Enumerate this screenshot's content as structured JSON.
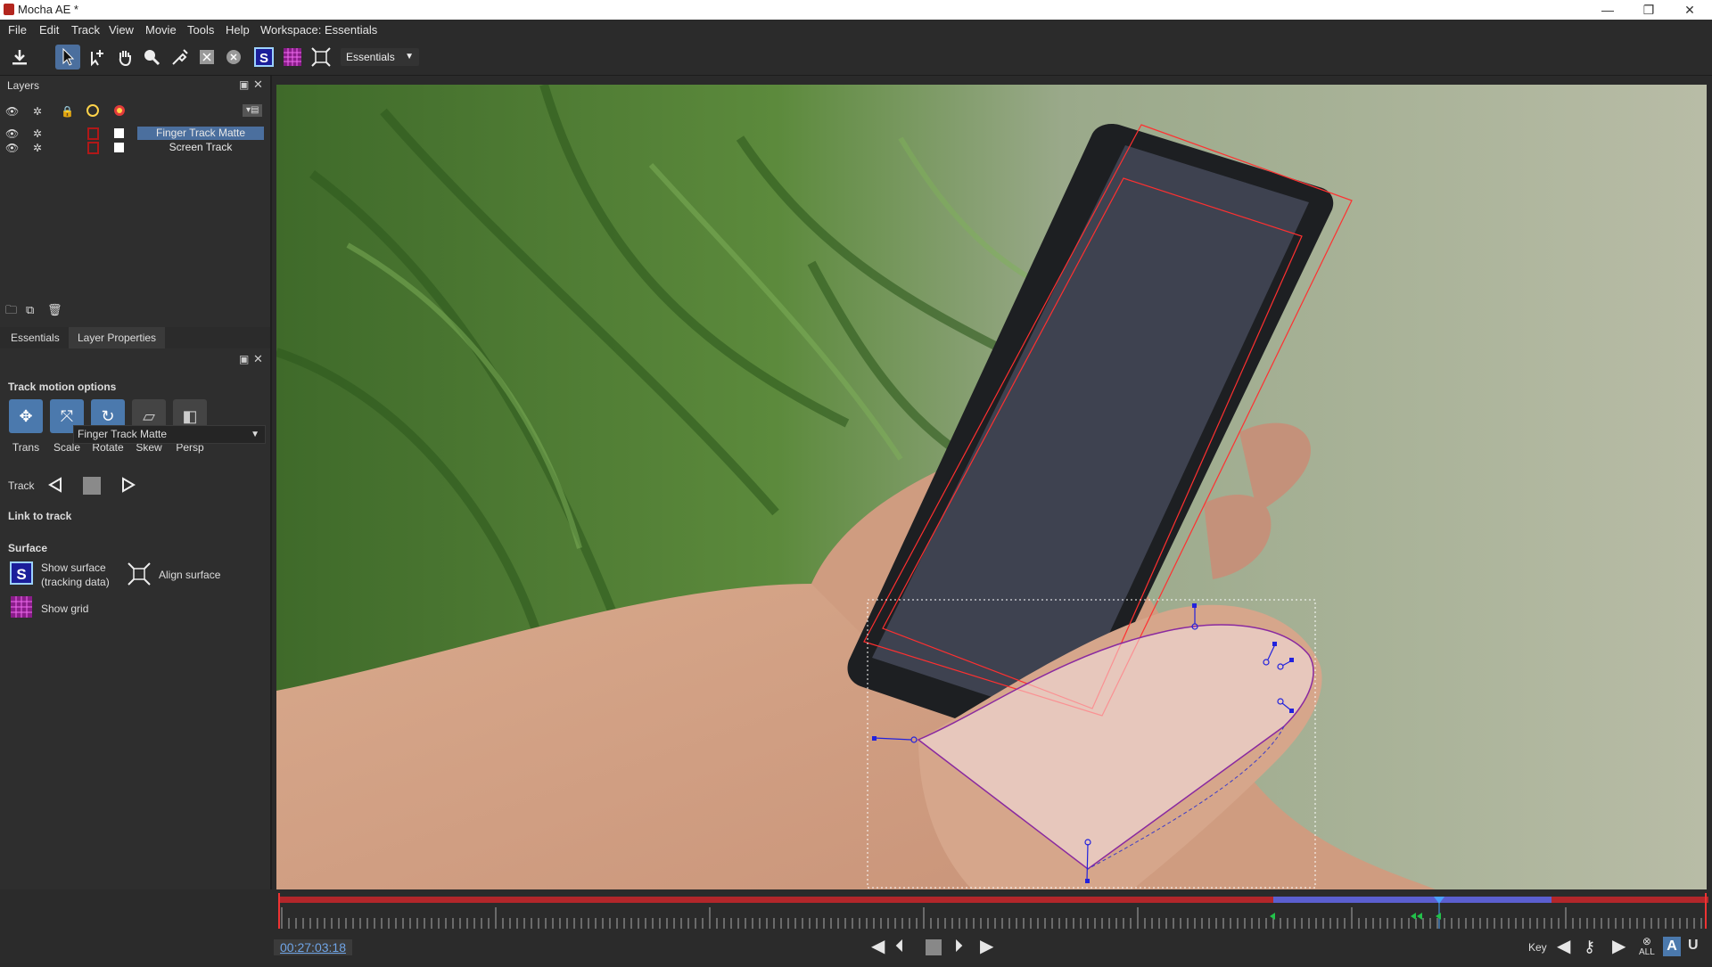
{
  "window": {
    "title": "Mocha AE *",
    "minimize": "—",
    "maximize": "❐",
    "close": "✕"
  },
  "menu": [
    "File",
    "Edit",
    "Track",
    "View",
    "Movie",
    "Tools",
    "Help",
    "Workspace: Essentials"
  ],
  "toolbar": {
    "workspace_dropdown": "Essentials",
    "tools": [
      "save-icon",
      "pick-tool-icon",
      "add-point-icon",
      "hand-tool-icon",
      "zoom-tool-icon",
      "pen-tool-icon",
      "x-spline-rect-icon",
      "x-spline-circle-icon",
      "show-surface-icon",
      "show-grid-icon",
      "align-surface-icon"
    ]
  },
  "layers_panel": {
    "title": "Layers",
    "layers": [
      {
        "name": "Finger Track Matte",
        "selected": true
      },
      {
        "name": "Screen Track",
        "selected": false
      }
    ]
  },
  "props_tabs": [
    "Essentials",
    "Layer Properties"
  ],
  "essentials": {
    "track_motion_title": "Track motion options",
    "motion_options": [
      {
        "label": "Trans",
        "icon": "translate-icon",
        "on": true
      },
      {
        "label": "Scale",
        "icon": "scale-icon",
        "on": true
      },
      {
        "label": "Rotate",
        "icon": "rotate-icon",
        "on": true
      },
      {
        "label": "Skew",
        "icon": "skew-icon",
        "on": false
      },
      {
        "label": "Persp",
        "icon": "perspective-icon",
        "on": false
      }
    ],
    "track_label": "Track",
    "link_label": "Link to track",
    "link_value": "Finger Track Matte",
    "surface_title": "Surface",
    "show_surface_l1": "Show surface",
    "show_surface_l2": "(tracking data)",
    "align_surface": "Align surface",
    "show_grid": "Show grid"
  },
  "timeline": {
    "timecode": "00:27:03:18",
    "key_label": "Key",
    "all_label": "ALL",
    "colors": {
      "track_range": "#b3262a",
      "selection": "#5b5fd0",
      "playhead": "#4aa0ff"
    }
  }
}
